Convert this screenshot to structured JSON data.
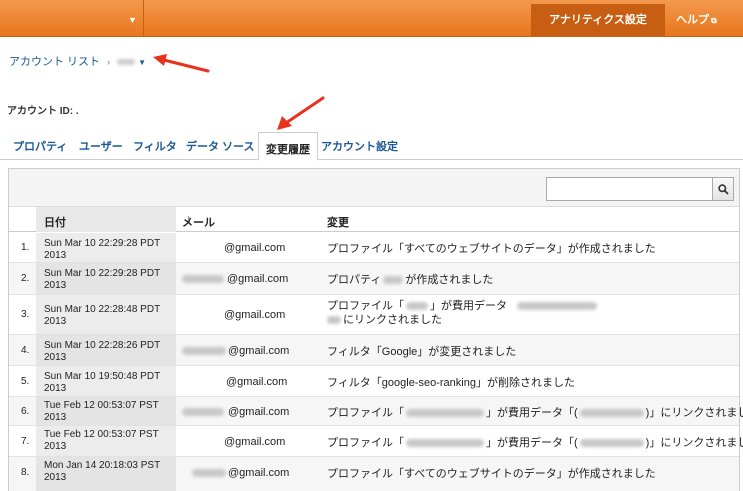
{
  "topbar": {
    "settings_label": "アナリティクス設定",
    "help_label": "ヘルプ",
    "help_icon": "external-link-icon"
  },
  "breadcrumb": {
    "account_list": "アカウント リスト",
    "separator": "›"
  },
  "account_id_label": "アカウント ID: .",
  "tabs": [
    "プロパティ",
    "ユーザー",
    "フィルタ",
    "データ ソース",
    "変更履歴",
    "アカウント設定"
  ],
  "active_tab": "変更履歴",
  "search": {
    "placeholder": "",
    "icon": "search-icon"
  },
  "table": {
    "headers": {
      "date": "日付",
      "email": "メール",
      "change": "変更"
    },
    "sort_indicator": "↓",
    "rows": [
      {
        "num": "1.",
        "date": "Sun Mar 10 22:29:28 PDT 2013",
        "email": "@gmail.com",
        "change": "プロファイル「すべてのウェブサイトのデータ」が作成されました"
      },
      {
        "num": "2.",
        "date": "Sun Mar 10 22:29:28 PDT 2013",
        "email": "@gmail.com",
        "change_a": "プロパティ",
        "change_b": "が作成されました"
      },
      {
        "num": "3.",
        "date": "Sun Mar 10 22:28:48 PDT 2013",
        "email": "@gmail.com",
        "change_a": "プロファイル「",
        "change_b": "」が費用データ",
        "change_c": "にリンクされました"
      },
      {
        "num": "4.",
        "date": "Sun Mar 10 22:28:26 PDT 2013",
        "email": "@gmail.com",
        "change": "フィルタ「Google」が変更されました"
      },
      {
        "num": "5.",
        "date": "Sun Mar 10 19:50:48 PDT 2013",
        "email": "@gmail.com",
        "change": "フィルタ「google-seo-ranking」が削除されました"
      },
      {
        "num": "6.",
        "date": "Tue Feb 12 00:53:07 PST 2013",
        "email": "@gmail.com",
        "change_a": "プロファイル「",
        "change_b": "」が費用データ「(",
        "change_c": ")」にリンクされました"
      },
      {
        "num": "7.",
        "date": "Tue Feb 12 00:53:07 PST 2013",
        "email": "@gmail.com",
        "change_a": "プロファイル「",
        "change_b": "」が費用データ「(",
        "change_c": ")」にリンクされました"
      },
      {
        "num": "8.",
        "date": "Mon Jan 14 20:18:03 PST 2013",
        "email": "@gmail.com",
        "change": "プロファイル「すべてのウェブサイトのデータ」が作成されました"
      }
    ]
  },
  "colors": {
    "topbar": "#e8761e",
    "link": "#1a5896",
    "annotation_arrow": "#e8321e"
  }
}
